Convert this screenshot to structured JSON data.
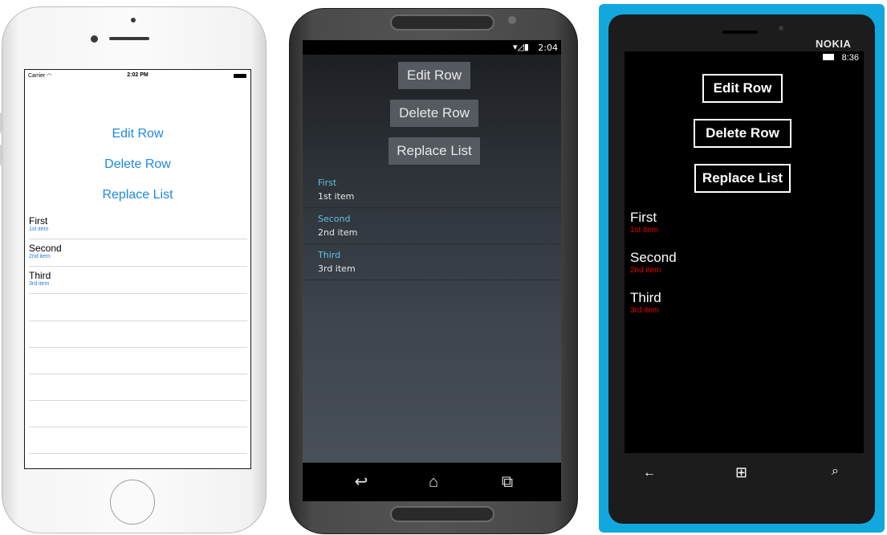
{
  "ios": {
    "carrier": "Carrier",
    "wifi": "◠",
    "time": "2:02 PM",
    "buttons": {
      "edit": "Edit Row",
      "delete": "Delete Row",
      "replace": "Replace List"
    },
    "items": [
      {
        "title": "First",
        "detail": "1st item"
      },
      {
        "title": "Second",
        "detail": "2nd item"
      },
      {
        "title": "Third",
        "detail": "3rd item"
      }
    ]
  },
  "android": {
    "time": "2:04",
    "status_icons": "▾◿▮",
    "buttons": {
      "edit": "Edit Row",
      "delete": "Delete Row",
      "replace": "Replace List"
    },
    "items": [
      {
        "title": "First",
        "detail": "1st item"
      },
      {
        "title": "Second",
        "detail": "2nd item"
      },
      {
        "title": "Third",
        "detail": "3rd item"
      }
    ],
    "nav": {
      "back": "↩",
      "home": "⌂",
      "recents": "⧉"
    }
  },
  "nokia": {
    "brand": "NOKIA",
    "time": "8:36",
    "buttons": {
      "edit": "Edit Row",
      "delete": "Delete Row",
      "replace": "Replace List"
    },
    "items": [
      {
        "title": "First",
        "detail": "1st item"
      },
      {
        "title": "Second",
        "detail": "2nd item"
      },
      {
        "title": "Third",
        "detail": "3rd item"
      }
    ],
    "nav": {
      "back": "←",
      "start": "⊞",
      "search": "⌕"
    }
  },
  "colors": {
    "ios_accent": "#1e88e5",
    "android_accent": "#5fc3e6",
    "nokia_detail": "#e60000",
    "nokia_body": "#12a8df"
  }
}
